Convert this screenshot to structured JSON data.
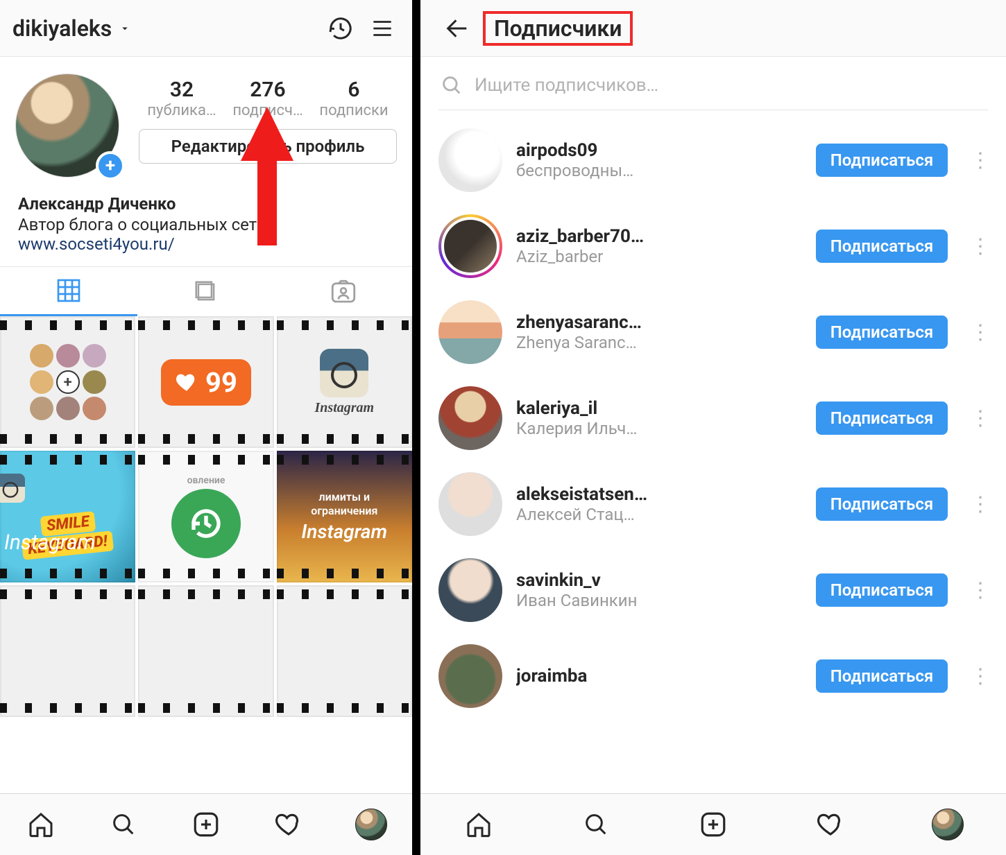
{
  "left": {
    "username": "dikiyaleks",
    "stats": {
      "posts": {
        "count": "32",
        "label": "публика…"
      },
      "followers": {
        "count": "276",
        "label": "подписч…"
      },
      "following": {
        "count": "6",
        "label": "подписки"
      }
    },
    "edit_button": "Редактировать профиль",
    "bio": {
      "name": "Александр Диченко",
      "text": "Автор блога о социальных сетях",
      "link": "www.socseti4you.ru/"
    },
    "grid": {
      "like_count": "99",
      "ig_text": "Instagram",
      "smile_line1": "SMILE",
      "smile_line2": "KEYBOARD!",
      "update_text": "овление",
      "sunset_line1": "лимиты и",
      "sunset_line2": "ограничения",
      "sunset_ig": "Instagram"
    }
  },
  "right": {
    "title": "Подписчики",
    "search_placeholder": "Ищите подписчиков…",
    "follow_label": "Подписаться",
    "followers": [
      {
        "username": "airpods09",
        "display": "беспроводны…",
        "avatar": "av0",
        "story": false
      },
      {
        "username": "aziz_barber70…",
        "display": "Aziz_barber",
        "avatar": "av1",
        "story": true
      },
      {
        "username": "zhenyasaranc…",
        "display": "Zhenya Saranc…",
        "avatar": "av2",
        "story": false
      },
      {
        "username": "kaleriya_il",
        "display": "Калерия Ильч…",
        "avatar": "av3",
        "story": false
      },
      {
        "username": "alekseistatsen…",
        "display": "Алексей Стац…",
        "avatar": "av4",
        "story": false
      },
      {
        "username": "savinkin_v",
        "display": "Иван Савинкин",
        "avatar": "av5",
        "story": false
      },
      {
        "username": "joraimba",
        "display": "",
        "avatar": "av6",
        "story": false
      }
    ]
  }
}
